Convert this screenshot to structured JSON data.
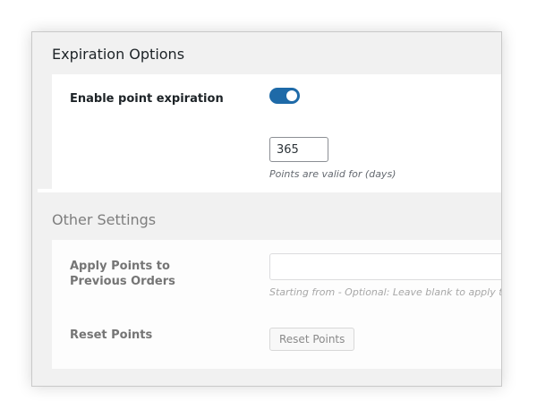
{
  "expiration": {
    "title": "Expiration Options",
    "enable_label": "Enable point expiration",
    "enable_on": true,
    "days_value": "365",
    "days_help": "Points are valid for (days)"
  },
  "other": {
    "title": "Other Settings",
    "apply_label": "Apply Points to Previous Orders",
    "apply_value": "",
    "apply_help": "Starting from - Optional: Leave blank to apply to a",
    "reset_label": "Reset Points",
    "reset_button": "Reset Points"
  },
  "colors": {
    "toggle_on": "#1e6aa8"
  }
}
